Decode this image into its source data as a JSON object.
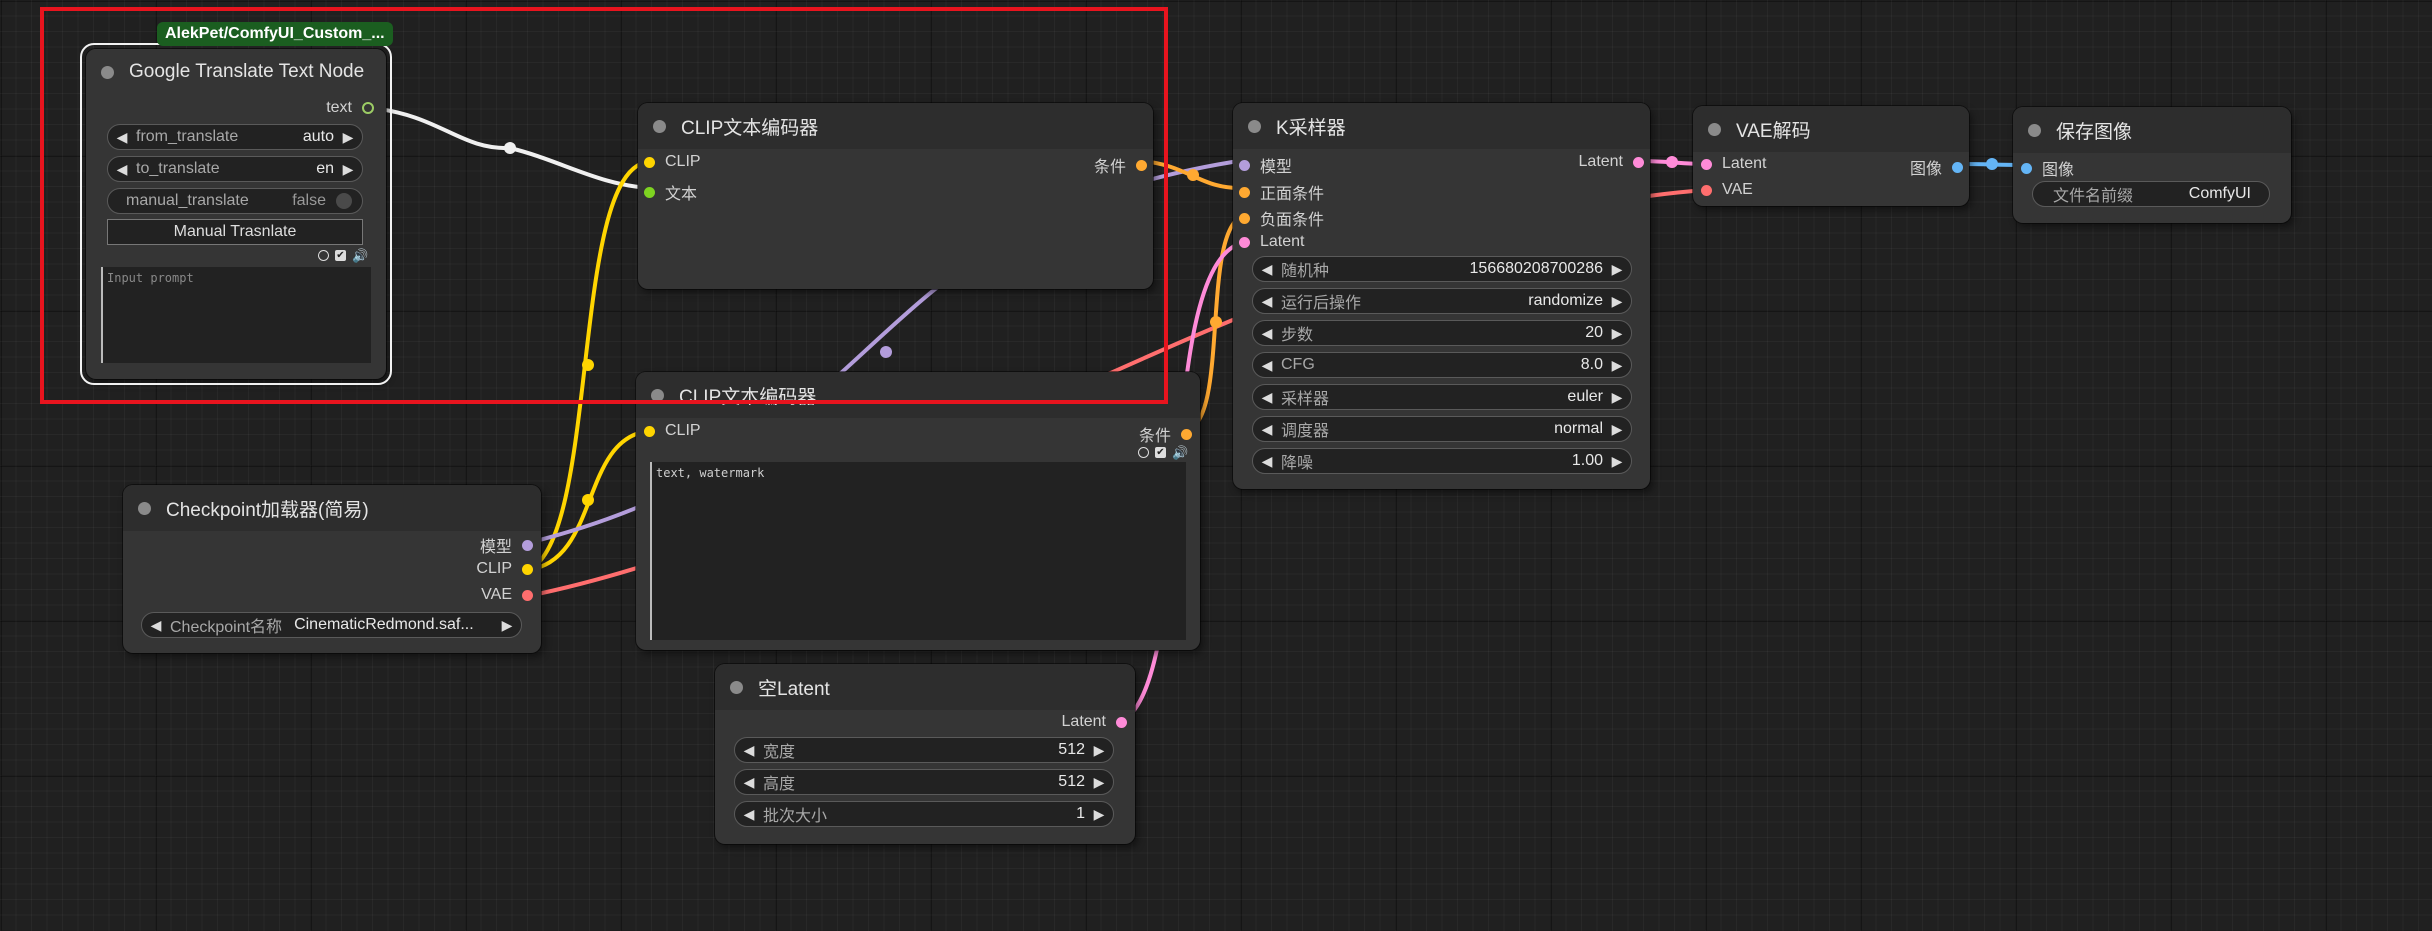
{
  "colors": {
    "clip": "#ffd500",
    "model": "#b39ddb",
    "vae": "#ff6e6e",
    "latent": "#ff8bd8",
    "conditioning": "#ffa931",
    "image": "#64b5f6",
    "string": "#7ed321",
    "highlight": "#e8141e",
    "badge": "#1b5e20"
  },
  "google_translate": {
    "badge": "AlekPet/ComfyUI_Custom_...",
    "title": "Google Translate Text Node",
    "out_text": "text",
    "from_label": "from_translate",
    "from_value": "auto",
    "to_label": "to_translate",
    "to_value": "en",
    "manual_label": "manual_translate",
    "manual_value": "false",
    "button": "Manual Trasnlate",
    "placeholder": "Input prompt"
  },
  "clip_encoder_1": {
    "title": "CLIP文本编码器",
    "in_clip": "CLIP",
    "in_text": "文本",
    "out_cond": "条件"
  },
  "clip_encoder_2": {
    "title": "CLIP文本编码器",
    "in_clip": "CLIP",
    "out_cond": "条件",
    "text": "text, watermark"
  },
  "checkpoint": {
    "title": "Checkpoint加载器(简易)",
    "out_model": "模型",
    "out_clip": "CLIP",
    "out_vae": "VAE",
    "ckpt_label": "Checkpoint名称",
    "ckpt_value": "CinematicRedmond.saf..."
  },
  "ksampler": {
    "title": "K采样器",
    "in_model": "模型",
    "in_positive": "正面条件",
    "in_negative": "负面条件",
    "in_latent": "Latent",
    "out_latent": "Latent",
    "widgets": [
      {
        "label": "随机种",
        "value": "156680208700286"
      },
      {
        "label": "运行后操作",
        "value": "randomize"
      },
      {
        "label": "步数",
        "value": "20"
      },
      {
        "label": "CFG",
        "value": "8.0"
      },
      {
        "label": "采样器",
        "value": "euler"
      },
      {
        "label": "调度器",
        "value": "normal"
      },
      {
        "label": "降噪",
        "value": "1.00"
      }
    ]
  },
  "vae_decode": {
    "title": "VAE解码",
    "in_latent": "Latent",
    "in_vae": "VAE",
    "out_image": "图像"
  },
  "save_image": {
    "title": "保存图像",
    "in_image": "图像",
    "prefix_label": "文件名前缀",
    "prefix_value": "ComfyUI"
  },
  "empty_latent": {
    "title": "空Latent",
    "out_latent": "Latent",
    "widgets": [
      {
        "label": "宽度",
        "value": "512"
      },
      {
        "label": "高度",
        "value": "512"
      },
      {
        "label": "批次大小",
        "value": "1"
      }
    ]
  }
}
